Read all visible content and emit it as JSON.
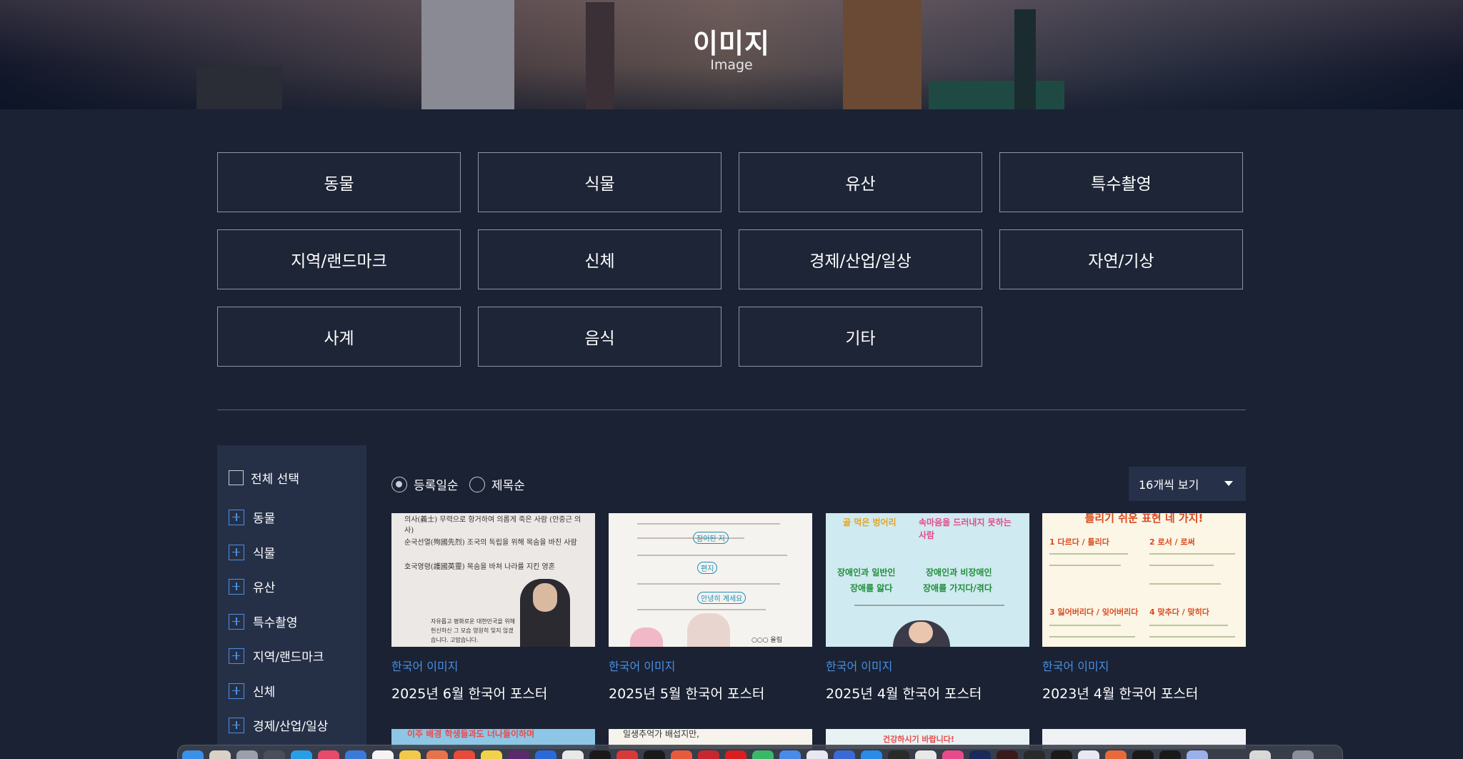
{
  "hero": {
    "title": "이미지",
    "subtitle": "Image"
  },
  "categories": [
    "동물",
    "식물",
    "유산",
    "특수촬영",
    "지역/랜드마크",
    "신체",
    "경제/산업/일상",
    "자연/기상",
    "사계",
    "음식",
    "기타"
  ],
  "sidebar": {
    "select_all": "전체 선택",
    "items": [
      "동물",
      "식물",
      "유산",
      "특수촬영",
      "지역/랜드마크",
      "신체",
      "경제/산업/일상"
    ]
  },
  "sort": {
    "option1": "등록일순",
    "option2": "제목순",
    "selected": "등록일순"
  },
  "per_page": "16개씩 보기",
  "cards": [
    {
      "category": "한국어 이미지",
      "title": "2025년 6월 한국어 포스터",
      "thumb_text": [
        "의사(義士) 무력으로 항거하여 의롭게 죽은 사람 (안중근 의사)",
        "순국선열(殉國先烈) 조국의 독립을 위해 목숨을 바친 사람",
        "호국영령(護國英靈) 목숨을 바쳐 나라를 지킨 영혼",
        "자유롭고 평화로운 대한민국을 위해 헌신하신 그 모습 영원히 잊지 않겠습니다. 고맙습니다."
      ]
    },
    {
      "category": "한국어 이미지",
      "title": "2025년 5월 한국어 포스터",
      "thumb_text": [
        "잠어된 지",
        "편지",
        "안녕히 계세요",
        "○○○ 올림"
      ]
    },
    {
      "category": "한국어 이미지",
      "title": "2025년 4월 한국어 포스터",
      "thumb_text": [
        "골 먹은 벙어리",
        "속마음을 드러내지 못하는 사람",
        "장애인과 일반인",
        "장애인과 비장애인",
        "장애를 앓다",
        "장애를 가지다/겪다"
      ]
    },
    {
      "category": "한국어 이미지",
      "title": "2023년 4월 한국어 포스터",
      "thumb_text": [
        "틀리기 쉬운 표현 네 가지!",
        "1 다르다 / 틀리다",
        "2 로서 / 로써",
        "3 잃어버리다 / 잊어버리다",
        "4 맞추다 / 맞히다"
      ]
    }
  ],
  "second_row_text": [
    "이주 배경 학생들과도 너나들이하며",
    "일생추억가 배섭지만,",
    "건강하시기 바랍니다!",
    "한국어 이미지"
  ],
  "colors": {
    "background": "#1a2233",
    "accent": "#4b8fe2",
    "sidebar": "#253047"
  }
}
